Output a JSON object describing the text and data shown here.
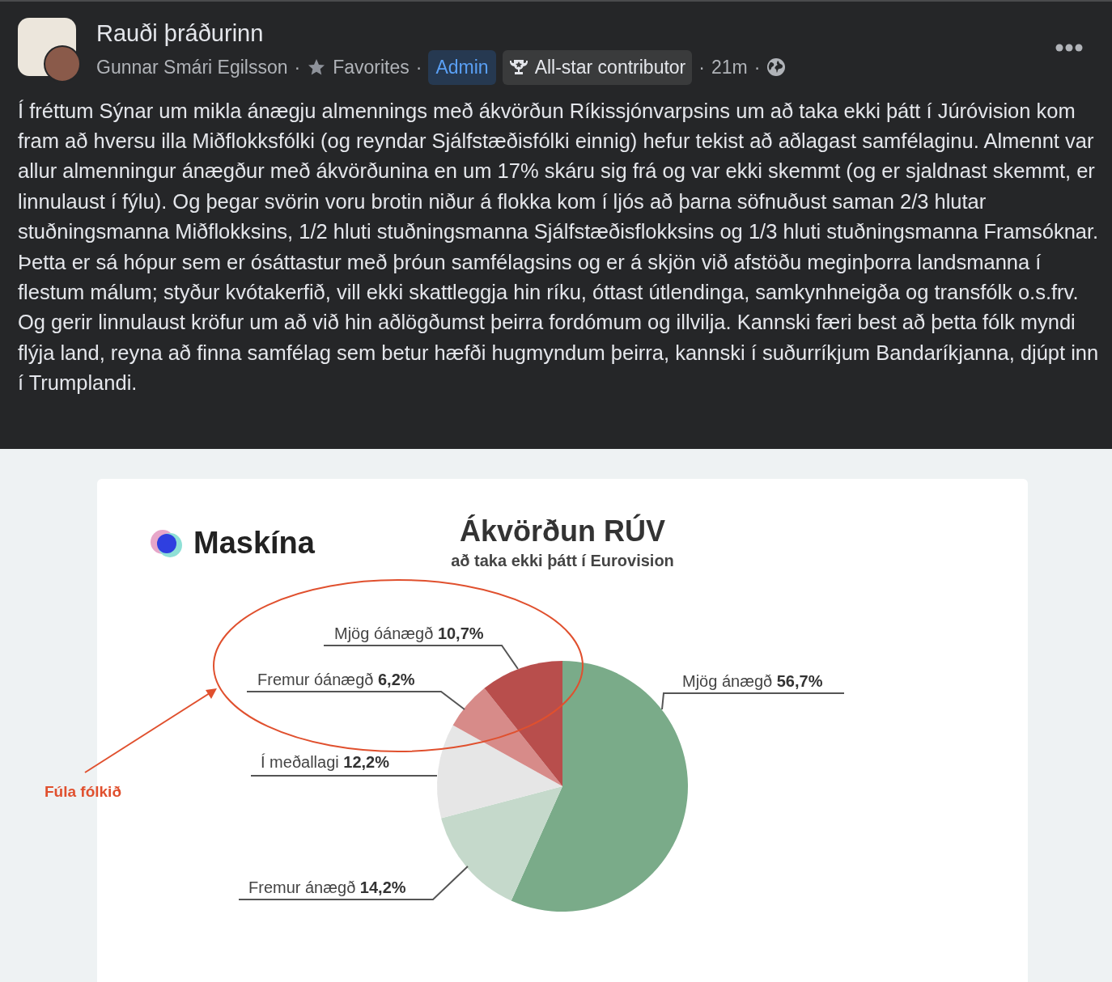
{
  "post": {
    "group_name": "Rauði þráðurinn",
    "author": "Gunnar Smári Egilsson",
    "favorites_label": "Favorites",
    "badges": [
      {
        "kind": "admin",
        "label": "Admin"
      },
      {
        "kind": "contributor",
        "label": "All-star contributor"
      }
    ],
    "time": "21m",
    "separator": "·",
    "body": "Í fréttum Sýnar um mikla ánægju almennings með ákvörðun Ríkissjónvarpsins um að taka ekki þátt í Júróvision kom fram að hversu illa Miðflokksfólki (og reyndar Sjálfstæðisfólki einnig) hefur tekist að aðlagast samfélaginu. Almennt var allur almenningur ánægður með ákvörðunina en um 17% skáru sig frá og var ekki skemmt (og er sjaldnast skemmt, er linnulaust í fýlu). Og þegar svörin voru brotin niður á flokka kom í ljós að þarna söfnuðust saman 2/3 hlutar stuðningsmanna Miðflokksins, 1/2 hluti stuðningsmanna Sjálfstæðisflokksins og 1/3 hluti stuðningsmanna Framsóknar. Þetta er sá hópur sem er ósáttastur með þróun samfélagsins og er á skjön við afstöðu meginþorra landsmanna í flestum málum; styður kvótakerfið, vill ekki skattleggja hin ríku, óttast útlendinga, samkynhneigða og transfólk o.s.frv. Og gerir linnulaust kröfur um að við hin aðlögðumst þeirra fordómum og illvilja. Kannski færi best að þetta fólk myndi flýja land, reyna að finna samfélag sem betur hæfði hugmyndum þeirra, kannski í suðurríkjum Bandaríkjanna, djúpt inn í Trumplandi."
  },
  "image": {
    "logo_text": "Maskína",
    "subtitle": "að taka ekki þátt í Eurovision",
    "annotation": "Fúla fólkið",
    "chart_data": {
      "type": "pie",
      "title": "Ákvörðun RÚV",
      "categories": [
        "Mjög ánægð",
        "Fremur ánægð",
        "Í meðallagi",
        "Fremur óánægð",
        "Mjög óánægð"
      ],
      "values": [
        56.7,
        14.2,
        12.2,
        6.2,
        10.7
      ],
      "value_labels": [
        "56,7%",
        "14,2%",
        "12,2%",
        "6,2%",
        "10,7%"
      ],
      "colors": [
        "#7aab89",
        "#c5d9cb",
        "#e6e6e6",
        "#d78b89",
        "#b84e4c"
      ],
      "data_labels": true
    }
  }
}
